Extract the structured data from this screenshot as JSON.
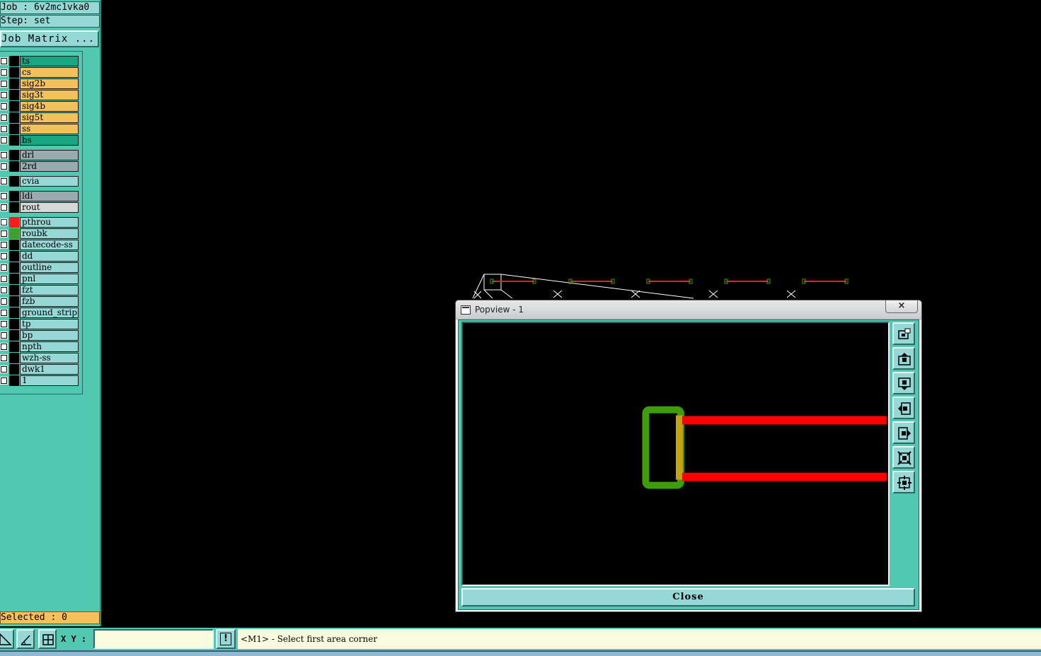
{
  "header": {
    "job_label": "Job  :  6v2mc1vka0",
    "step_label": "Step:  set",
    "job_matrix_label": "Job Matrix ..."
  },
  "layers": [
    {
      "name": "ts",
      "bg": "#19a783"
    },
    {
      "name": "cs",
      "bg": "#f4c15a"
    },
    {
      "name": "sig2b",
      "bg": "#f4c15a"
    },
    {
      "name": "sig3t",
      "bg": "#f4c15a"
    },
    {
      "name": "sig4b",
      "bg": "#f4c15a"
    },
    {
      "name": "sig5t",
      "bg": "#f4c15a"
    },
    {
      "name": "ss",
      "bg": "#f4c15a"
    },
    {
      "name": "bs",
      "bg": "#19a783"
    },
    {
      "name": "drl",
      "bg": "#99aab0"
    },
    {
      "name": "2rd",
      "bg": "#99aab0"
    },
    {
      "name": "cvia",
      "bg": "#96d8d6"
    },
    {
      "name": "ldi",
      "bg": "#99aab0"
    },
    {
      "name": "rout",
      "bg": "#d8d8d8"
    },
    {
      "name": "pthrou",
      "bg": "#96d8d6",
      "color": "#ff1a1a",
      "checked_blue": true
    },
    {
      "name": "roubk",
      "bg": "#96d8d6",
      "color": "#3ca02a"
    },
    {
      "name": "datecode-ss",
      "bg": "#96d8d6"
    },
    {
      "name": "dd",
      "bg": "#96d8d6"
    },
    {
      "name": "outline",
      "bg": "#96d8d6"
    },
    {
      "name": "pnl",
      "bg": "#96d8d6"
    },
    {
      "name": "fzt",
      "bg": "#96d8d6"
    },
    {
      "name": "fzb",
      "bg": "#96d8d6"
    },
    {
      "name": "ground_strip",
      "bg": "#96d8d6"
    },
    {
      "name": "tp",
      "bg": "#96d8d6"
    },
    {
      "name": "bp",
      "bg": "#96d8d6"
    },
    {
      "name": "npth",
      "bg": "#96d8d6"
    },
    {
      "name": "wzh-ss",
      "bg": "#96d8d6"
    },
    {
      "name": "dwk1",
      "bg": "#96d8d6"
    },
    {
      "name": "1",
      "bg": "#96d8d6"
    }
  ],
  "selected_label": "Selected : 0",
  "status": {
    "xy_label": "X Y :",
    "xy_value": "",
    "warn_label": "!",
    "prompt": "<M1> - Select first area corner"
  },
  "popview": {
    "title": "Popview - 1",
    "close_x": "×",
    "close_label": "Close"
  },
  "colors": {
    "panel_teal": "#52c8b0",
    "trace_red": "#ff0000",
    "pad_green": "#3f9c0a",
    "pad_yellow": "#c3a213"
  }
}
